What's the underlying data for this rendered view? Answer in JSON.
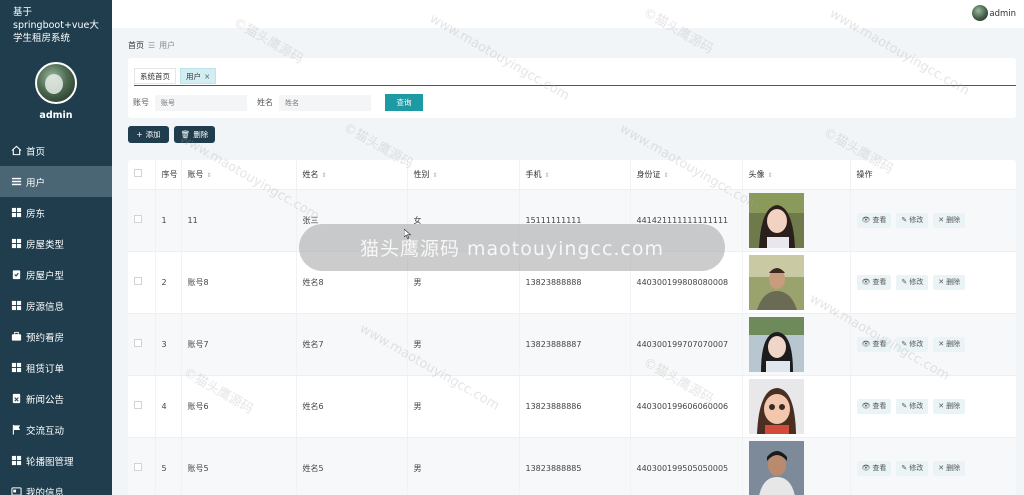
{
  "app": {
    "title_line1": "基于",
    "title_line2": "springboot+vue大",
    "title_line3": "学生租房系统"
  },
  "sidebar": {
    "username": "admin",
    "items": [
      {
        "label": "首页",
        "icon": "home-icon"
      },
      {
        "label": "用户",
        "icon": "list-icon"
      },
      {
        "label": "房东",
        "icon": "grid-icon"
      },
      {
        "label": "房屋类型",
        "icon": "grid-icon"
      },
      {
        "label": "房屋户型",
        "icon": "clipboard-icon"
      },
      {
        "label": "房源信息",
        "icon": "grid-icon"
      },
      {
        "label": "预约看房",
        "icon": "briefcase-icon"
      },
      {
        "label": "租赁订单",
        "icon": "grid-icon"
      },
      {
        "label": "新闻公告",
        "icon": "doc-icon"
      },
      {
        "label": "交流互动",
        "icon": "flag-icon"
      },
      {
        "label": "轮播图管理",
        "icon": "grid-icon"
      },
      {
        "label": "我的信息",
        "icon": "card-icon"
      }
    ]
  },
  "topbar": {
    "username": "admin"
  },
  "breadcrumb": {
    "home": "首页",
    "current": "用户"
  },
  "tabs": {
    "home": "系统首页",
    "current": "用户",
    "close": "×"
  },
  "search": {
    "account_label": "账号",
    "account_placeholder": "账号",
    "name_label": "姓名",
    "name_placeholder": "姓名",
    "button": "查询"
  },
  "actions": {
    "add": "添加",
    "delete": "删除"
  },
  "table": {
    "headers": {
      "index": "序号",
      "account": "账号",
      "name": "姓名",
      "gender": "性别",
      "phone": "手机",
      "id_card": "身份证",
      "avatar": "头像",
      "ops": "操作"
    },
    "row_buttons": {
      "view": "查看",
      "edit": "修改",
      "delete": "删除"
    },
    "rows": [
      {
        "index": "1",
        "account": "11",
        "name": "张三",
        "gender": "女",
        "phone": "15111111111",
        "id_card": "441421111111111111"
      },
      {
        "index": "2",
        "account": "账号8",
        "name": "姓名8",
        "gender": "男",
        "phone": "13823888888",
        "id_card": "440300199808080008"
      },
      {
        "index": "3",
        "account": "账号7",
        "name": "姓名7",
        "gender": "男",
        "phone": "13823888887",
        "id_card": "440300199707070007"
      },
      {
        "index": "4",
        "account": "账号6",
        "name": "姓名6",
        "gender": "男",
        "phone": "13823888886",
        "id_card": "440300199606060006"
      },
      {
        "index": "5",
        "account": "账号5",
        "name": "姓名5",
        "gender": "男",
        "phone": "13823888885",
        "id_card": "440300199505050005"
      }
    ]
  },
  "overlay": {
    "text": "猫头鹰源码 maotouyingcc.com"
  },
  "watermark": {
    "brand": "©猫头鹰源码",
    "url": "www.maotouyingcc.com"
  },
  "colors": {
    "sidebar": "#1f3d4d",
    "accent": "#1e9aa4",
    "active_menu": "#4a6674"
  }
}
